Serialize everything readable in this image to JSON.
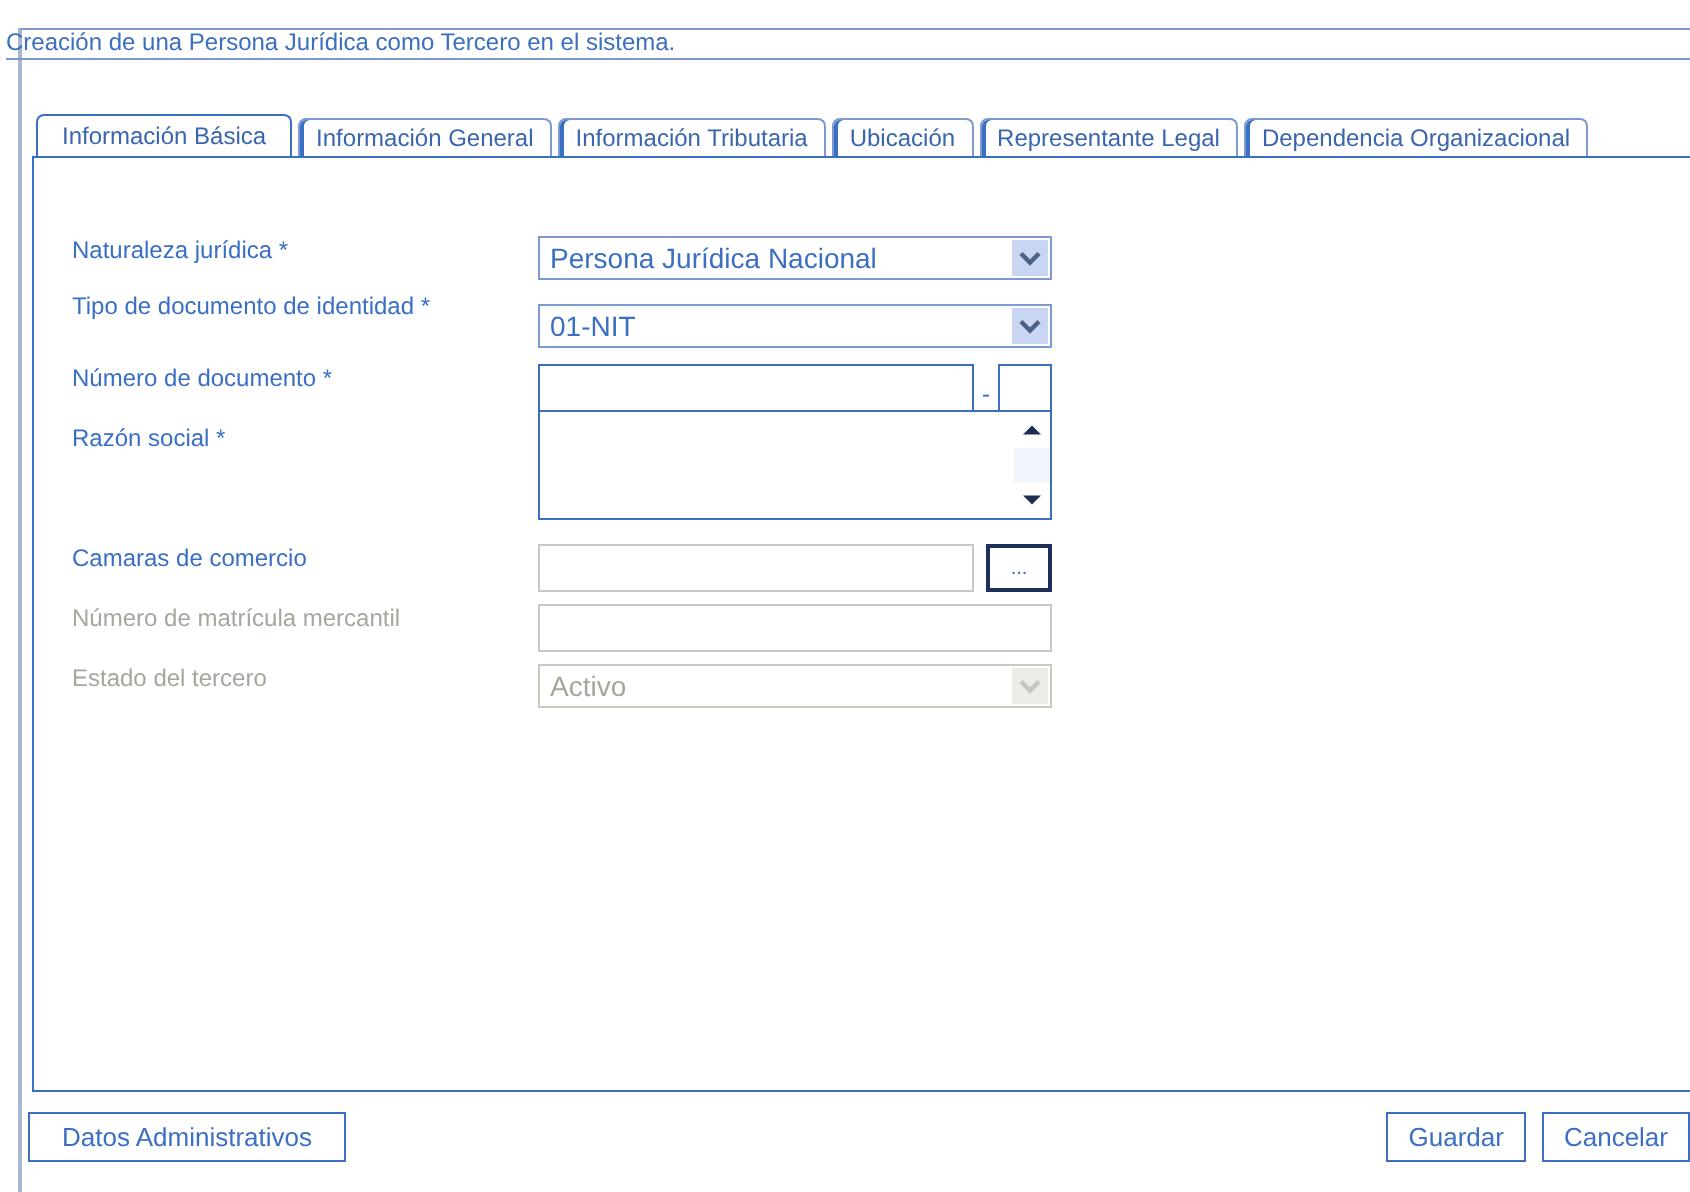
{
  "title": "Creación de una Persona Jurídica como Tercero en el sistema.",
  "tabs": [
    {
      "label": "Información Básica",
      "selected": true
    },
    {
      "label": "Información General",
      "selected": false
    },
    {
      "label": "Información Tributaria",
      "selected": false
    },
    {
      "label": "Ubicación",
      "selected": false
    },
    {
      "label": "Representante Legal",
      "selected": false
    },
    {
      "label": "Dependencia Organizacional",
      "selected": false
    }
  ],
  "fields": [
    {
      "label": "Naturaleza jurídica *",
      "kind": "select",
      "value": "Persona Jurídica Nacional",
      "disabled": false
    },
    {
      "label": "Tipo de documento de identidad *",
      "kind": "select",
      "value": "01-NIT",
      "disabled": false
    },
    {
      "label": "Número de documento *",
      "kind": "number",
      "separator": "-",
      "disabled": false
    },
    {
      "label": "Razón social *",
      "kind": "textarea",
      "disabled": false
    },
    {
      "label": "Camaras de comercio",
      "kind": "lookup",
      "button": "...",
      "disabled": false
    },
    {
      "label": "Número de matrícula mercantil",
      "kind": "text",
      "disabled": true
    },
    {
      "label": "Estado del tercero",
      "kind": "select",
      "value": "Activo",
      "disabled": true
    }
  ],
  "left_buttons": [
    "Datos Administrativos"
  ],
  "right_buttons": [
    "Guardar",
    "Cancelar"
  ]
}
